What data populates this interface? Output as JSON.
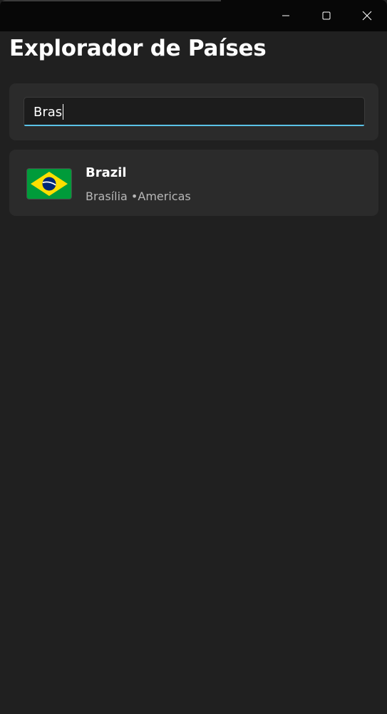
{
  "window": {
    "controls": {
      "minimize_icon": "minimize-icon",
      "maximize_icon": "maximize-icon",
      "close_icon": "close-icon"
    }
  },
  "header": {
    "title": "Explorador de Países"
  },
  "search": {
    "value": "Bras",
    "accent_color": "#5bc2e7"
  },
  "results": [
    {
      "name": "Brazil",
      "capital": "Brasília",
      "separator": " •",
      "region": "Americas",
      "flag_icon": "brazil-flag-icon"
    }
  ],
  "colors": {
    "background": "#202020",
    "card": "#2b2b2b",
    "titlebar": "#070707"
  }
}
